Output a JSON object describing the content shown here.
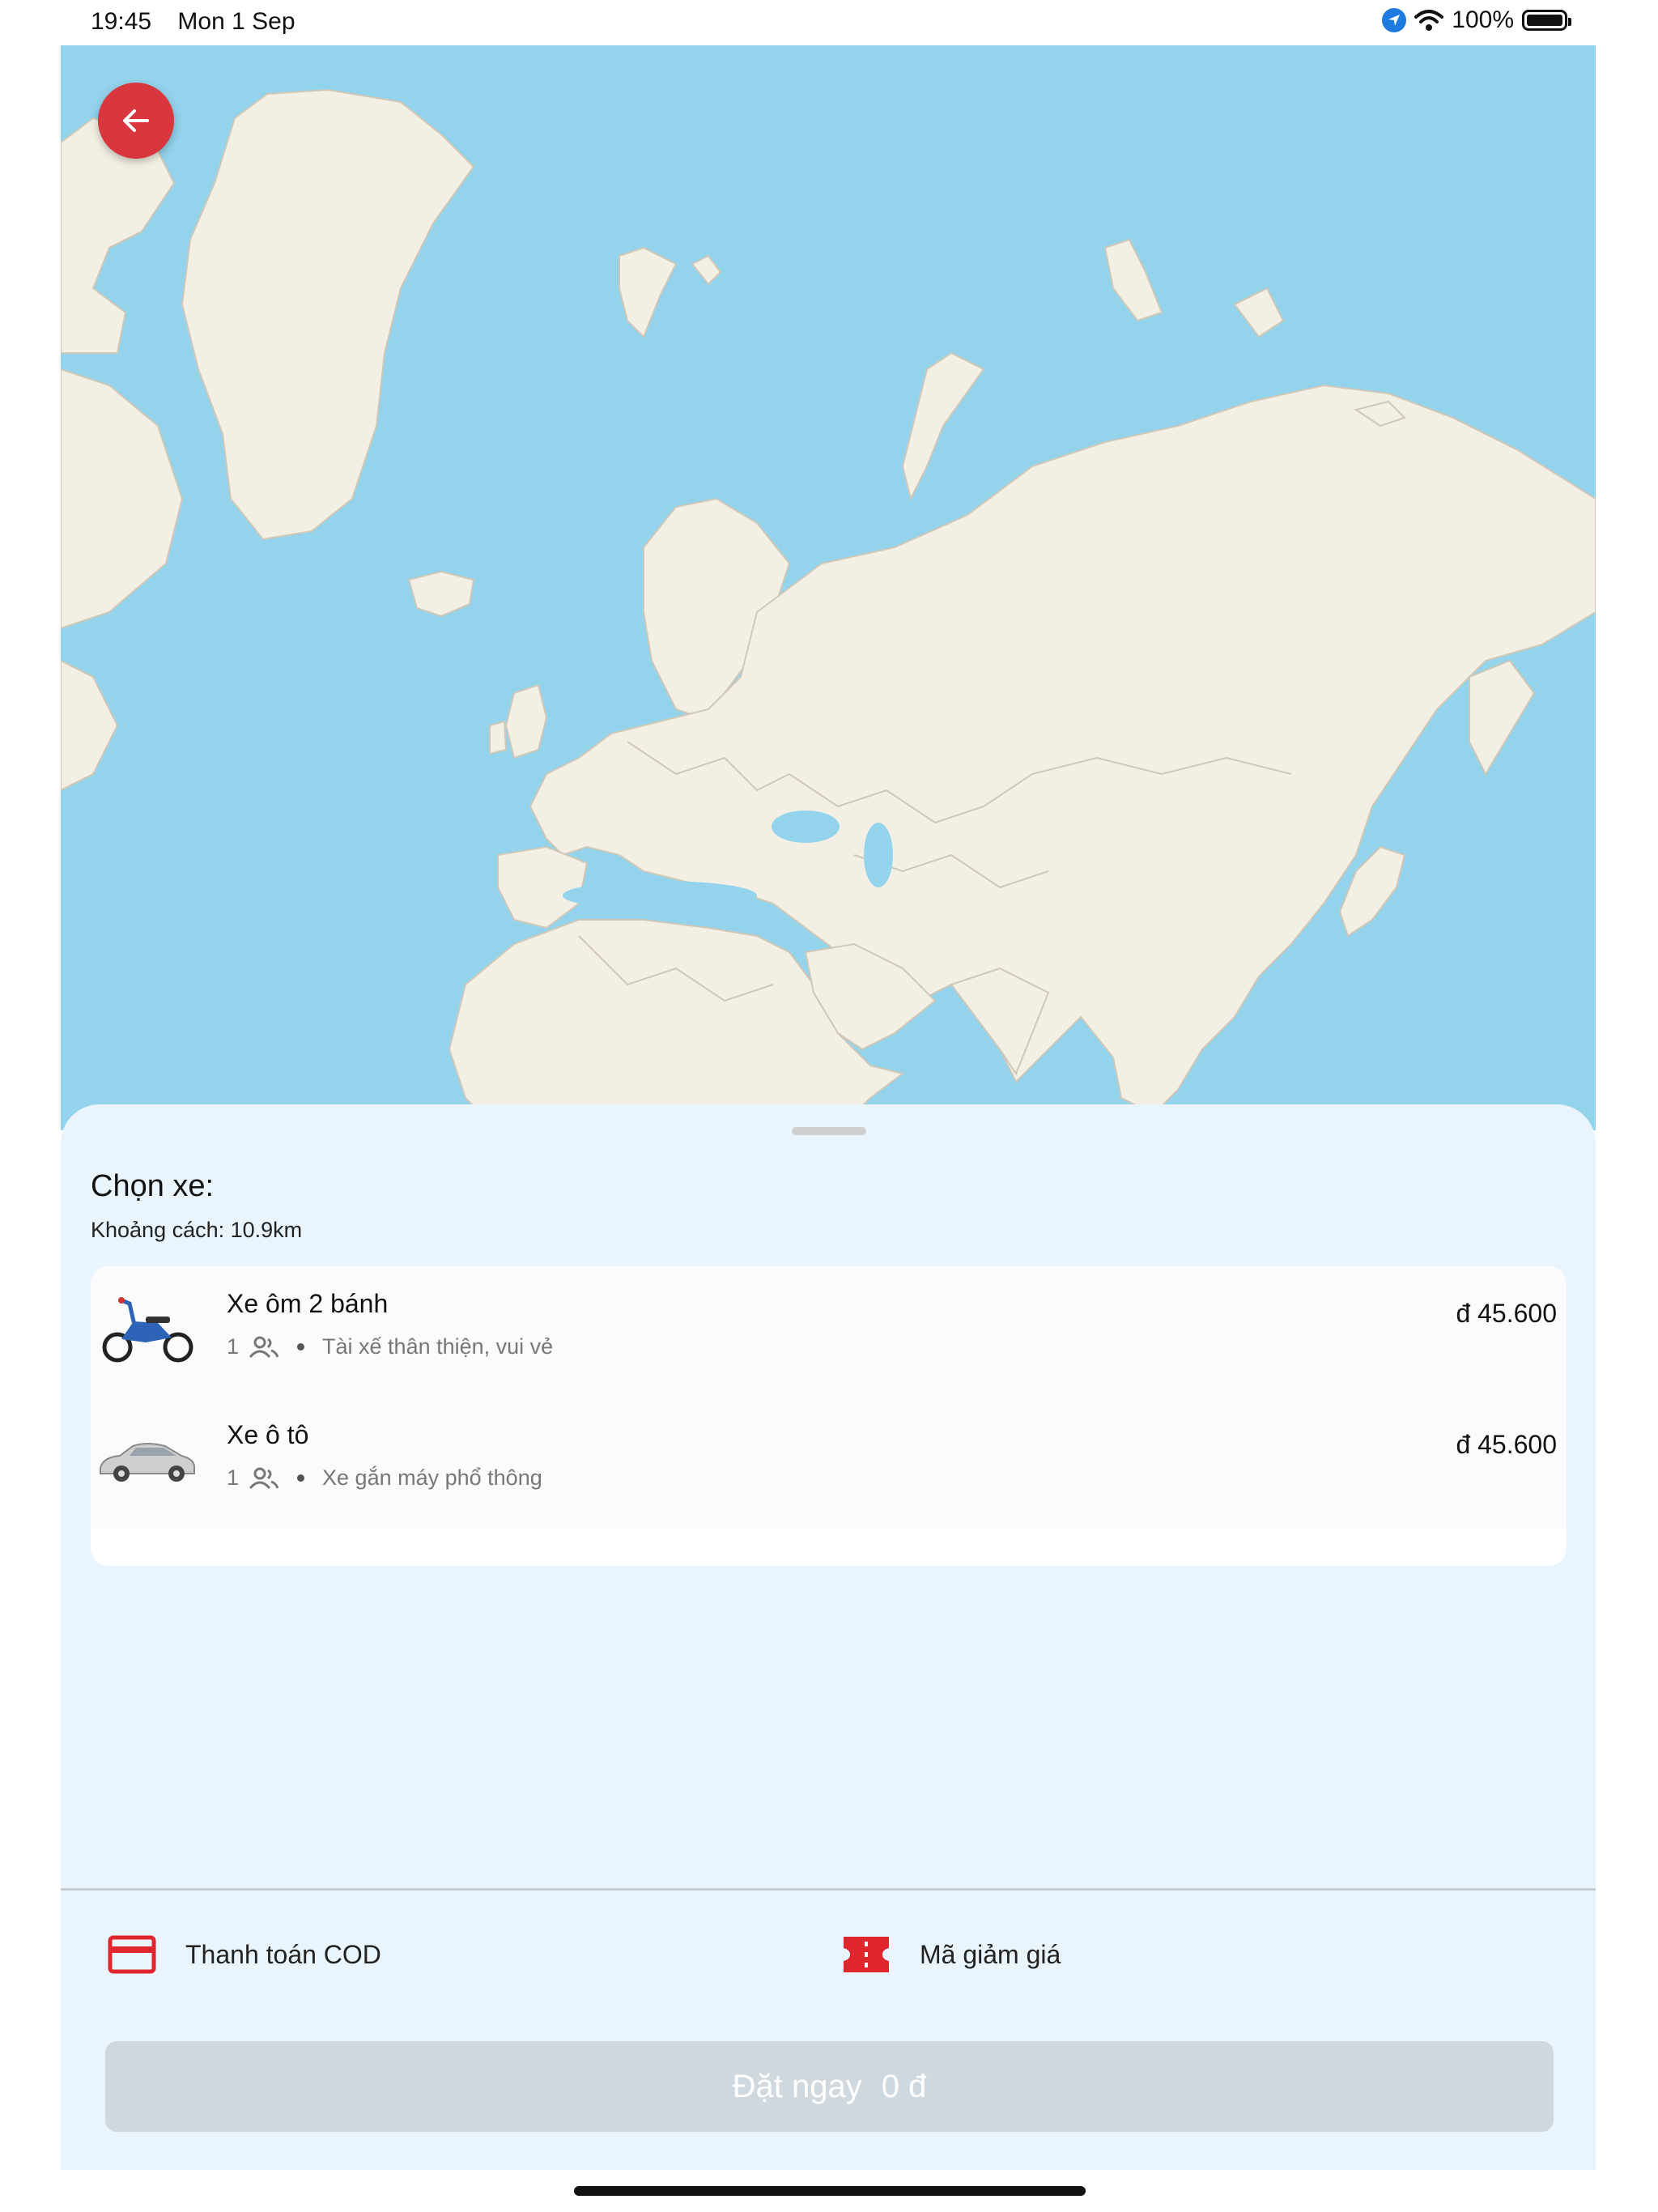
{
  "status_bar": {
    "time": "19:45",
    "date": "Mon 1 Sep",
    "battery": "100%"
  },
  "map": {
    "back_icon": "arrow-left-icon",
    "back_color": "#d9363e",
    "water_color": "#93d3ec",
    "land_color": "#f3efe4"
  },
  "sheet": {
    "title": "Chọn xe:",
    "distance": "Khoảng cách: 10.9km",
    "options": [
      {
        "name": "Xe ôm 2 bánh",
        "capacity": "1",
        "description": "Tài xế thân thiện, vui vẻ",
        "price": "đ 45.600",
        "icon": "scooter-icon"
      },
      {
        "name": "Xe ô tô",
        "capacity": "1",
        "description": "Xe gắn máy phổ thông",
        "price": "đ 45.600",
        "icon": "car-icon"
      }
    ]
  },
  "footer": {
    "payment_label": "Thanh toán COD",
    "payment_icon": "credit-card-icon",
    "voucher_label": "Mã giảm giá",
    "voucher_icon": "ticket-icon",
    "accent_color": "#e0262d",
    "book_label": "Đặt ngay",
    "book_amount": "0 đ"
  }
}
